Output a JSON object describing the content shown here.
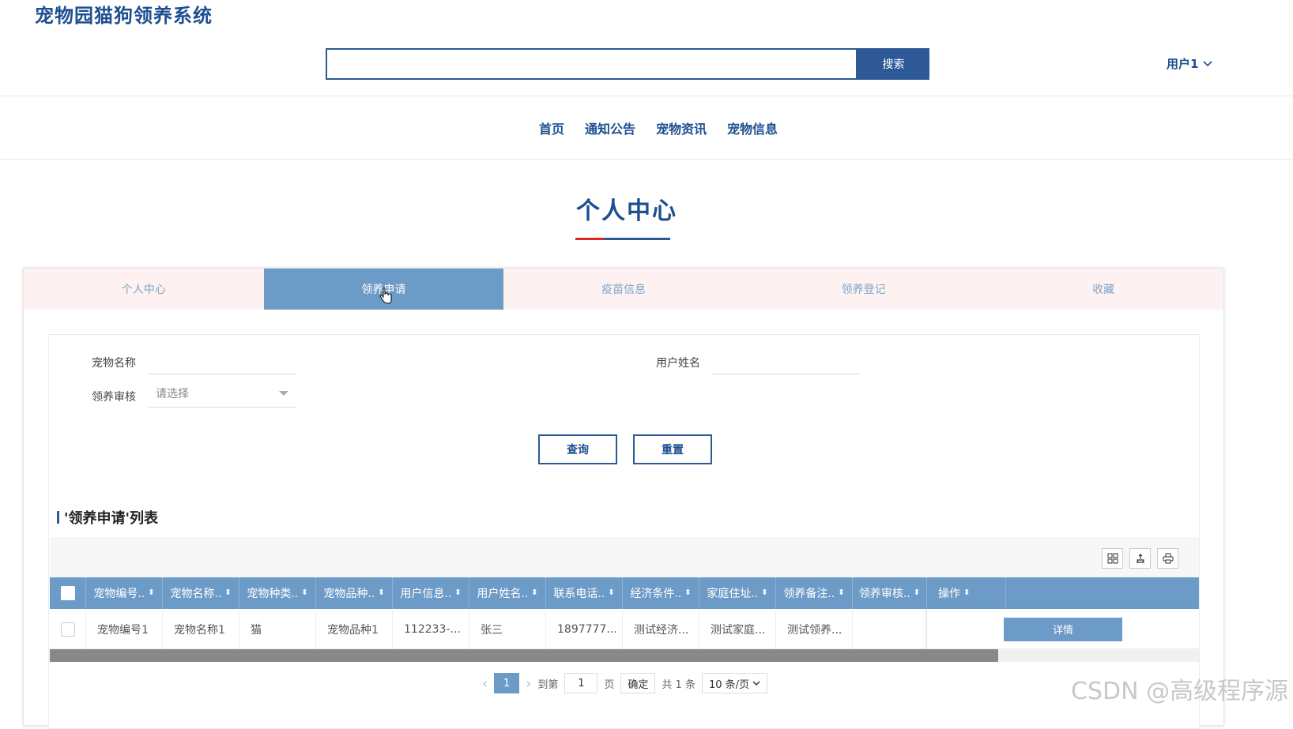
{
  "app": {
    "title": "宠物园猫狗领养系统"
  },
  "header": {
    "search_button": "搜索",
    "search_value": "",
    "user": "用户1"
  },
  "nav": [
    "首页",
    "通知公告",
    "宠物资讯",
    "宠物信息"
  ],
  "page_title": "个人中心",
  "tabs": [
    "个人中心",
    "领养申请",
    "疫苗信息",
    "领养登记",
    "收藏"
  ],
  "filters": {
    "pet_name_label": "宠物名称",
    "user_name_label": "用户姓名",
    "review_label": "领养审核",
    "review_placeholder": "请选择",
    "query_button": "查询",
    "reset_button": "重置"
  },
  "list": {
    "title": "'领养申请'列表"
  },
  "table": {
    "columns": [
      "宠物编号..",
      "宠物名称..",
      "宠物种类..",
      "宠物品种..",
      "用户信息..",
      "用户姓名..",
      "联系电话..",
      "经济条件..",
      "家庭住址..",
      "领养备注..",
      "领养审核..",
      "操作"
    ],
    "rows": [
      {
        "cells": [
          "宠物编号1",
          "宠物名称1",
          "猫",
          "宠物品种1",
          "112233-...",
          "张三",
          "1897777...",
          "测试经济...",
          "测试家庭...",
          "测试领养...",
          ""
        ],
        "action": "详情"
      }
    ]
  },
  "pager": {
    "prev": "‹",
    "current": "1",
    "next": "›",
    "goto_label": "到第",
    "goto_value": "1",
    "page_unit": "页",
    "confirm": "确定",
    "total": "共 1 条",
    "page_size": "10 条/页"
  },
  "watermark": "CSDN @高级程序源",
  "colors": {
    "brand": "#1d4f91",
    "accent": "#6d9bc8",
    "tab_bg": "#fdf2f1"
  }
}
